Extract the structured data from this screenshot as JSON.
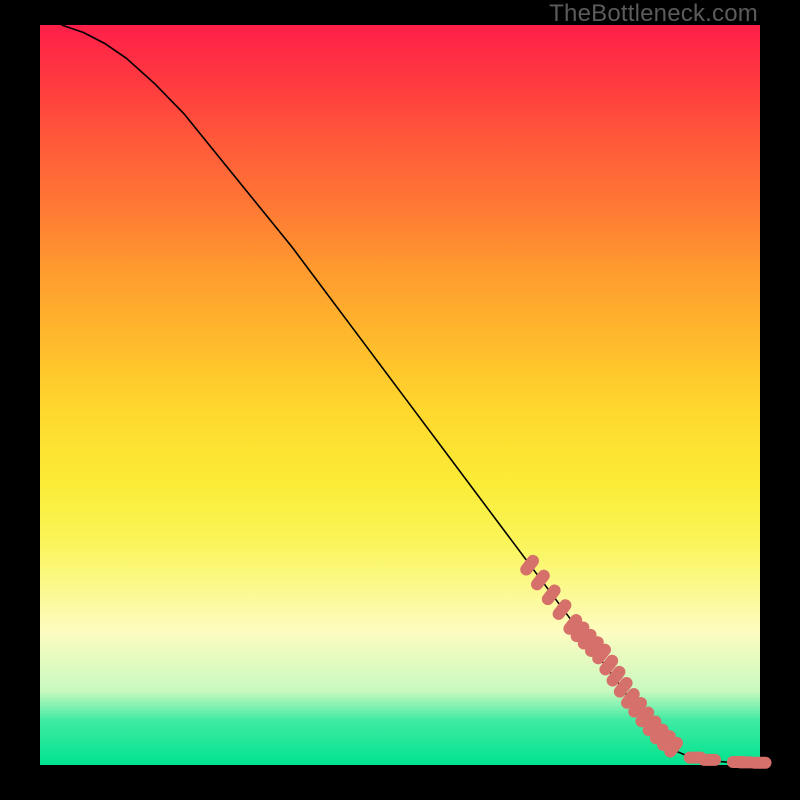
{
  "watermark": "TheBottleneck.com",
  "colors": {
    "background": "#000000",
    "curve": "#000000",
    "marker": "#d6706b",
    "gradient_top": "#ff1f49",
    "gradient_bottom": "#00e38f"
  },
  "chart_data": {
    "type": "line",
    "title": "",
    "xlabel": "",
    "ylabel": "",
    "xlim": [
      0,
      100
    ],
    "ylim": [
      0,
      100
    ],
    "series": [
      {
        "name": "curve",
        "x": [
          3,
          6,
          9,
          12,
          16,
          20,
          25,
          30,
          35,
          40,
          45,
          50,
          55,
          60,
          65,
          70,
          75,
          80,
          84,
          86,
          88,
          90,
          92,
          94,
          96,
          98,
          100
        ],
        "y": [
          100,
          99,
          97.5,
          95.5,
          92,
          88,
          82,
          76,
          70,
          63.5,
          57,
          50.5,
          44,
          37.5,
          31,
          24.5,
          18,
          11.5,
          6,
          3.5,
          2,
          1.2,
          0.8,
          0.5,
          0.35,
          0.3,
          0.3
        ]
      }
    ],
    "markers": {
      "name": "points",
      "x": [
        68,
        69.5,
        71,
        72.5,
        74,
        75,
        76,
        77,
        78,
        79,
        80,
        81,
        82,
        83,
        84,
        85,
        86,
        87,
        88,
        91,
        93,
        97,
        98,
        100
      ],
      "y": [
        27,
        25,
        23,
        21,
        19,
        18,
        17,
        16,
        15,
        13.5,
        12,
        10.5,
        9,
        7.8,
        6.5,
        5.3,
        4.2,
        3.3,
        2.4,
        1.0,
        0.7,
        0.4,
        0.35,
        0.3
      ]
    }
  }
}
